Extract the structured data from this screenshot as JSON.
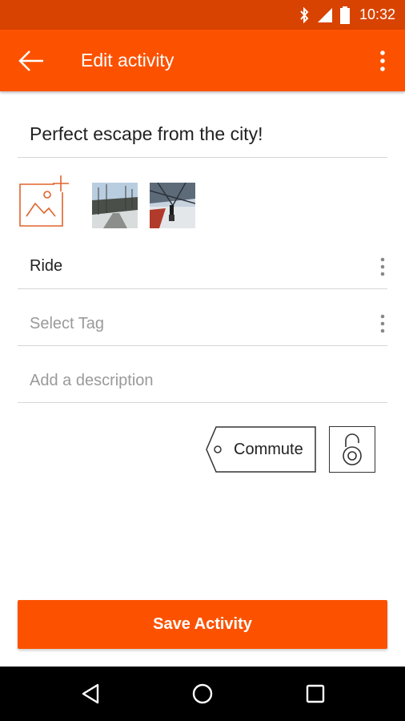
{
  "status_bar": {
    "time": "10:32",
    "icons": [
      "bluetooth-icon",
      "signal-icon",
      "battery-icon"
    ],
    "background": "#d84302"
  },
  "app_bar": {
    "title": "Edit activity",
    "back_icon": "back-arrow-icon",
    "menu_icon": "overflow-menu-icon",
    "background": "#fc5200"
  },
  "form": {
    "activity_name": "Perfect escape from the city!",
    "activity_type": "Ride",
    "tag_placeholder": "Select Tag",
    "description_placeholder": "Add a description"
  },
  "photos": {
    "add_icon": "add-photo-icon",
    "thumbnails": [
      "photo-thumbnail-1",
      "photo-thumbnail-2"
    ]
  },
  "toggles": {
    "commute_label": "Commute",
    "privacy_icon": "lock-icon"
  },
  "actions": {
    "save_label": "Save Activity",
    "accent": "#fc5200"
  },
  "nav_bar": {
    "icons": [
      "back-triangle-icon",
      "home-circle-icon",
      "recents-square-icon"
    ]
  }
}
